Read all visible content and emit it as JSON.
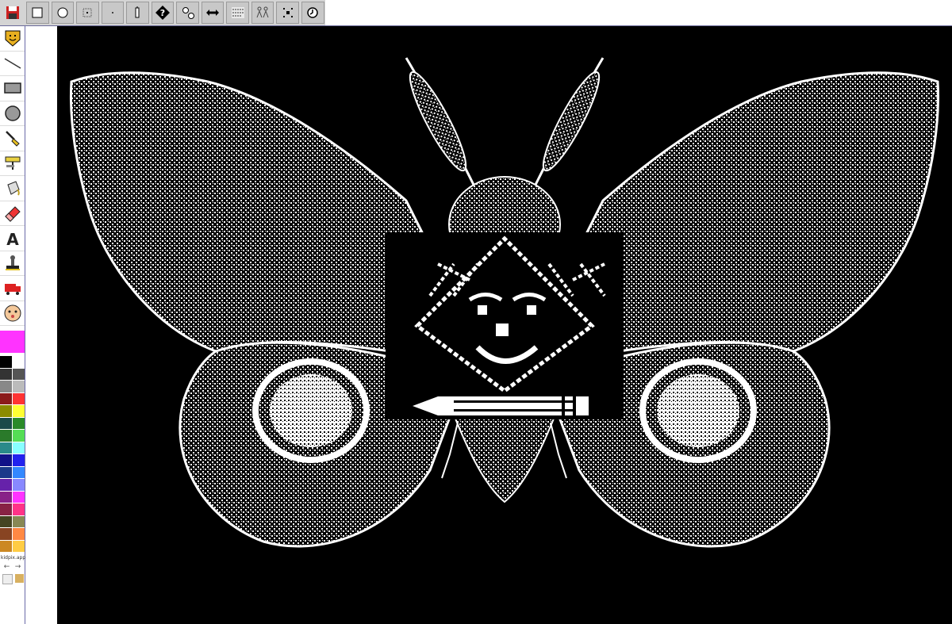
{
  "app": {
    "label": "kidpix.app"
  },
  "toolbar": {
    "items": [
      "save",
      "square-stamp",
      "circle-stamp",
      "dotted-square",
      "small-dot",
      "bug",
      "question",
      "two-circles",
      "swap",
      "letters",
      "people",
      "sparkle",
      "undo"
    ]
  },
  "tools": [
    "stamp-face",
    "line",
    "rectangle",
    "circle",
    "paintbrush",
    "roller",
    "bucket",
    "eraser",
    "text",
    "stamp",
    "truck",
    "face"
  ],
  "current_color": "#ff33ff",
  "palette": [
    "#000000",
    "#ffffff",
    "#333333",
    "#555555",
    "#888888",
    "#bbbbbb",
    "#8b1a1a",
    "#ff3333",
    "#8b8b00",
    "#ffff33",
    "#1a4a4a",
    "#2a8a2a",
    "#2a7a2a",
    "#55dd55",
    "#2a8a8a",
    "#88ffff",
    "#111188",
    "#2222ee",
    "#1a3a8a",
    "#3388ff",
    "#6622aa",
    "#8888ff",
    "#882288",
    "#ff33ff",
    "#882244",
    "#ff3388",
    "#444422",
    "#888855",
    "#884422",
    "#ff8844",
    "#cc8822",
    "#ffcc44"
  ],
  "nav": {
    "prev": "←",
    "next": "→"
  },
  "canvas": {
    "background": "#000000",
    "ink": "#ffffff"
  }
}
